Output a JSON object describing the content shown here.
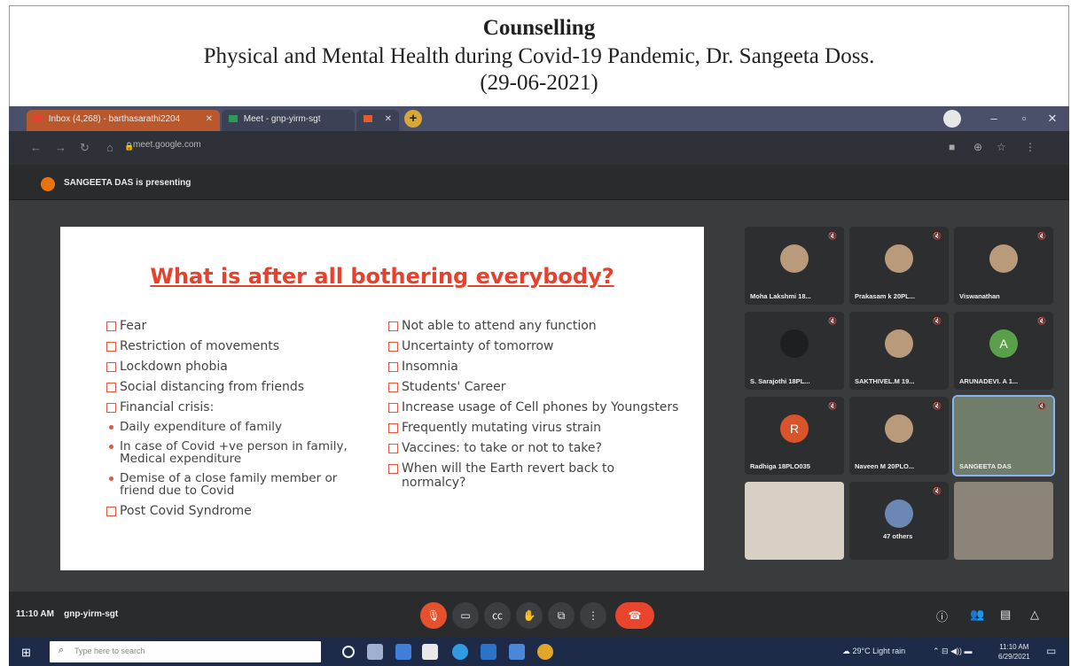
{
  "header": {
    "title": "Counselling",
    "subtitle": "Physical and Mental Health during Covid-19 Pandemic, Dr. Sangeeta Doss.",
    "date": "(29-06-2021)"
  },
  "browser": {
    "tabs": [
      {
        "label": "Inbox (4,268) - barthasarathi2204"
      },
      {
        "label": "Meet - gnp-yirm-sgt"
      },
      {
        "label": ""
      }
    ],
    "url": "meet.google.com"
  },
  "meet": {
    "presenting_text": "SANGEETA DAS is presenting",
    "meeting_time": "11:10 AM",
    "meeting_code": "gnp-yirm-sgt",
    "participants": [
      {
        "name": "Moha Lakshmi 18...",
        "type": "photo"
      },
      {
        "name": "Prakasam k 20PL...",
        "type": "photo"
      },
      {
        "name": "Viswanathan",
        "type": "photo"
      },
      {
        "name": "S. Sarajothi 18PL...",
        "type": "dark"
      },
      {
        "name": "SAKTHIVEL.M 19...",
        "type": "photo"
      },
      {
        "name": "ARUNADEVI. A 1...",
        "type": "letter",
        "letter": "A",
        "color": "#5aa04a"
      },
      {
        "name": "Radhiga 18PLO035",
        "type": "letter",
        "letter": "R",
        "color": "#d9542a"
      },
      {
        "name": "Naveen M 20PLO...",
        "type": "photo"
      },
      {
        "name": "SANGEETA DAS",
        "type": "video"
      },
      {
        "name": "",
        "type": "video"
      },
      {
        "name": "47 others",
        "type": "group"
      },
      {
        "name": "",
        "type": "video"
      }
    ]
  },
  "slide": {
    "title": "What is after all bothering everybody?",
    "left_items": [
      {
        "text": "Fear",
        "style": "box"
      },
      {
        "text": "Restriction of movements",
        "style": "box"
      },
      {
        "text": "Lockdown phobia",
        "style": "box"
      },
      {
        "text": "Social distancing from friends",
        "style": "box"
      },
      {
        "text": "Financial crisis:",
        "style": "box"
      },
      {
        "text": "Daily expenditure of family",
        "style": "dot"
      },
      {
        "text": "In case of Covid +ve person in family, Medical expenditure",
        "style": "dot"
      },
      {
        "text": "Demise of a close family member or friend due to Covid",
        "style": "dot"
      },
      {
        "text": "Post Covid Syndrome",
        "style": "box"
      }
    ],
    "right_items": [
      {
        "text": "Not able to attend any function",
        "style": "box"
      },
      {
        "text": "Uncertainty of tomorrow",
        "style": "box"
      },
      {
        "text": "Insomnia",
        "style": "box"
      },
      {
        "text": "Students' Career",
        "style": "box"
      },
      {
        "text": "Increase usage of Cell phones by Youngsters",
        "style": "box"
      },
      {
        "text": "Frequently mutating virus strain",
        "style": "box"
      },
      {
        "text": "Vaccines: to take or not to take?",
        "style": "box"
      },
      {
        "text": "When will the Earth revert back to normalcy?",
        "style": "box"
      }
    ]
  },
  "taskbar": {
    "search_placeholder": "Type here to search",
    "weather": "29°C Light rain",
    "clock_time": "11:10 AM",
    "clock_date": "6/29/2021"
  },
  "colors": {
    "slide_title": "#e8402a",
    "bullet": "#e0583d",
    "hangup": "#e8452c",
    "presenter_dot": "#e8730f"
  },
  "icons": {
    "start": "windows-icon",
    "search": "search-icon",
    "hangup": "phone-icon"
  }
}
